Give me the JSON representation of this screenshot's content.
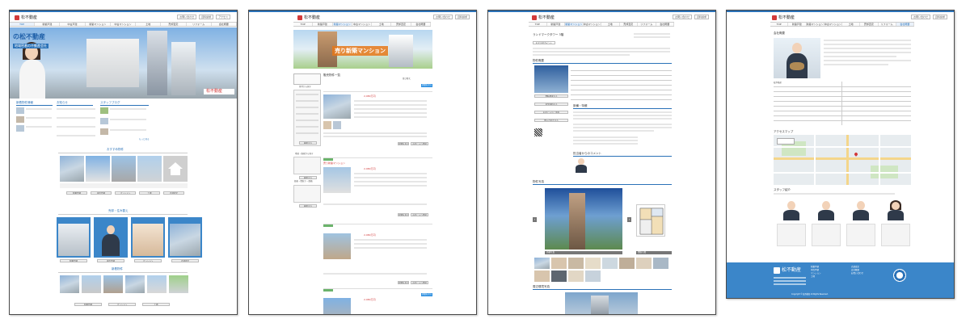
{
  "common": {
    "logo": "松不動産",
    "header_links": [
      "お問い合わせ",
      "資料請求",
      "アクセス"
    ],
    "nav": [
      "TOP",
      "新築戸建",
      "中古戸建",
      "新築マンション",
      "中古マンション",
      "土地",
      "売却査定",
      "リフォーム",
      "会社概要",
      "お問い合わせ"
    ]
  },
  "page1": {
    "hero_title": "の松不動産",
    "hero_sub": "地域密着の不動産会社",
    "sections": [
      "新着物件情報",
      "お知らせ",
      "スタッフブログ",
      "おすすめ物件",
      "売却・住み替え",
      "新着物件",
      "人気の物件"
    ],
    "buttons": [
      "新築戸建",
      "中古戸建",
      "マンション",
      "土地",
      "売却査定"
    ],
    "more_label": "もっと見る"
  },
  "page2": {
    "banner_text": "売り新築マンション",
    "side_headers": [
      "条件から探す",
      "地域・路線から探す",
      "価格・間取り・面積"
    ],
    "search_btn": "検索する",
    "list_title": "販売物件一覧",
    "sort": "並び替え",
    "price": "2,980万円",
    "detail_btn": "詳細を見る",
    "fav_btn": "お気に入り登録"
  },
  "page3": {
    "title": "ランドマークタワー 3階",
    "label_btn": "おすすめポイント",
    "sections": [
      "物件概要",
      "設備・特徴",
      "担当者からのコメント",
      "物件写真",
      "周辺環境写真"
    ],
    "side_buttons": [
      "資料請求する",
      "見学予約する",
      "お気に入りに追加",
      "問い合わせする"
    ],
    "tab_labels": [
      "外観写真",
      "間取り図"
    ]
  },
  "page4": {
    "title": "会社概要",
    "sections": [
      "会社概要",
      "アクセスマップ",
      "スタッフ紹介"
    ],
    "company_name": "松不動産",
    "footer_logo": "松不動産",
    "footer_menu": [
      "新築戸建",
      "中古戸建",
      "マンション",
      "土地",
      "売却査定",
      "会社概要",
      "お問い合わせ"
    ],
    "copyright": "Copyright © 松不動産 All Rights Reserved."
  },
  "colors": {
    "brand": "#2a72b8",
    "accent": "#d23a3a",
    "footer": "#3b86c9"
  }
}
